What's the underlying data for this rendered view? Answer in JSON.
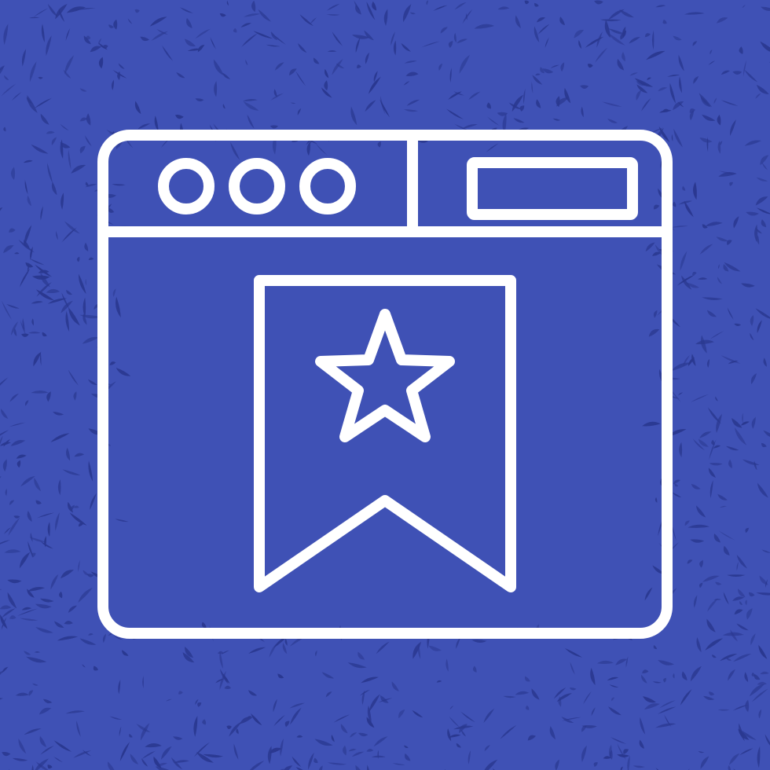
{
  "background": {
    "color": "#3f51b5",
    "texture_color": "#2a3890",
    "texture": "grunge-speckle-border"
  },
  "icon": {
    "name": "browser-bookmark-icon",
    "stroke_color": "#ffffff",
    "parts": {
      "window": "browser-window-frame",
      "dots": "window-control-dots",
      "address_bar": "address-bar",
      "bookmark": "bookmark-ribbon",
      "star": "star-icon"
    }
  }
}
